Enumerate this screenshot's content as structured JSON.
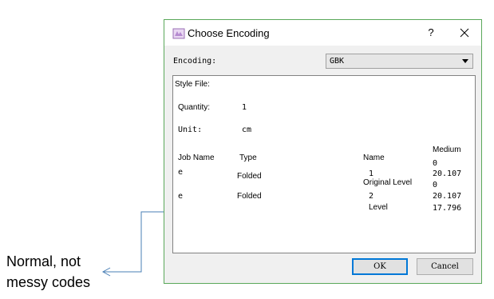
{
  "window": {
    "title": "Choose Encoding",
    "help_label": "?",
    "close_icon": "close-icon",
    "app_icon": "choose-encoding-app-icon",
    "accent": "#5aa85a"
  },
  "encoding": {
    "label": "Encoding:",
    "selected": "GBK"
  },
  "preview": {
    "style_file_label": "Style File:",
    "quantity_label": "Quantity:",
    "quantity_value": "1",
    "unit_label": "Unit:",
    "unit_value": "cm",
    "headers": {
      "job_name": "Job Name",
      "type": "Type",
      "name": "Name",
      "medium": "Medium"
    },
    "medium_first_value": "0",
    "rows": [
      {
        "job": "e",
        "type": "Folded",
        "name_index": "1",
        "name_extra": "Original Level",
        "medium_values": [
          "20.107",
          "0"
        ]
      },
      {
        "job": "e",
        "type": "Folded",
        "name_index": "2",
        "name_extra": "Level",
        "medium_values": [
          "20.107",
          "17.796"
        ]
      }
    ]
  },
  "buttons": {
    "ok": "OK",
    "cancel": "Cancel"
  },
  "annotation": {
    "line1": "Normal, not",
    "line2": "messy codes",
    "arrow_color": "#4a7fb5"
  }
}
